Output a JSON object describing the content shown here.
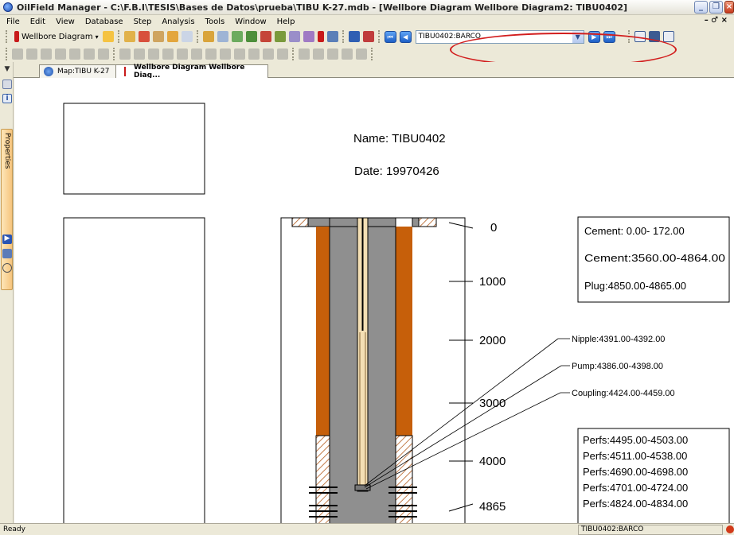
{
  "window": {
    "title": "OilField Manager - C:\\F.B.I\\TESIS\\Bases de Datos\\prueba\\TIBU K-27.mdb - [Wellbore Diagram Wellbore Diagram2: TIBU0402]"
  },
  "menu": {
    "items": [
      "File",
      "Edit",
      "View",
      "Database",
      "Step",
      "Analysis",
      "Tools",
      "Window",
      "Help"
    ],
    "right_glyph": "– ♂ ×"
  },
  "toolbar": {
    "view_selector_label": "Wellbore Diagram",
    "well_combo_value": "TIBU0402:BARCO"
  },
  "left_panel": {
    "properties_label": "Properties"
  },
  "tabs": [
    {
      "label": "Map:TIBU K-27"
    },
    {
      "label": "Wellbore Diagram Wellbore Diag..."
    }
  ],
  "diagram": {
    "name_line": "Name:  TIBU0402",
    "date_line": "Date:  19970426",
    "depth_labels": [
      "0",
      "1000",
      "2000",
      "3000",
      "4000",
      "4865"
    ],
    "cement_box": [
      "Cement:   0.00- 172.00",
      "Cement:3560.00-4864.00",
      "Plug:4850.00-4865.00"
    ],
    "equipment_labels": [
      "Nipple:4391.00-4392.00",
      "Pump:4386.00-4398.00",
      "Coupling:4424.00-4459.00"
    ],
    "perfs_box": [
      "Perfs:4495.00-4503.00",
      "Perfs:4511.00-4538.00",
      "Perfs:4690.00-4698.00",
      "Perfs:4701.00-4724.00",
      "Perfs:4824.00-4834.00"
    ]
  },
  "status": {
    "left": "Ready",
    "pane": "TIBU0402:BARCO"
  },
  "colors": {
    "casing_orange": "#c65f0a",
    "cement_gray": "#8f8f8f",
    "hatch_brown": "#b25a1c",
    "highlight_red": "#d21e1e"
  }
}
